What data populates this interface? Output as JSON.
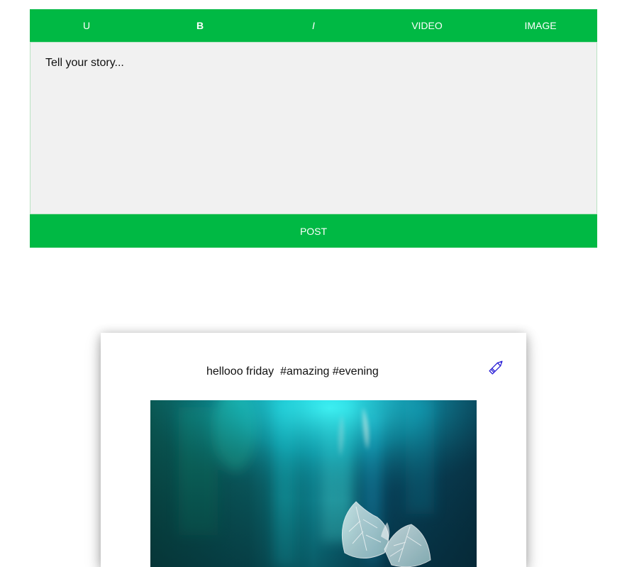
{
  "toolbar": {
    "underline_label": "U",
    "bold_label": "B",
    "italic_label": "I",
    "video_label": "VIDEO",
    "image_label": "IMAGE"
  },
  "composer": {
    "placeholder": "Tell your story...",
    "value": ""
  },
  "post_button": {
    "label": "POST"
  },
  "post": {
    "text": "hellooo friday  #amazing #evening",
    "edit_icon": "pencil-icon",
    "image_subject": "translucent skeleton leaves on teal bokeh background"
  },
  "colors": {
    "accent_green": "#00b944",
    "editor_background": "#f1f1f1",
    "edit_icon_color": "#2a1fd6",
    "image_teal": "#00c8d0",
    "image_dark": "#062c3a"
  }
}
